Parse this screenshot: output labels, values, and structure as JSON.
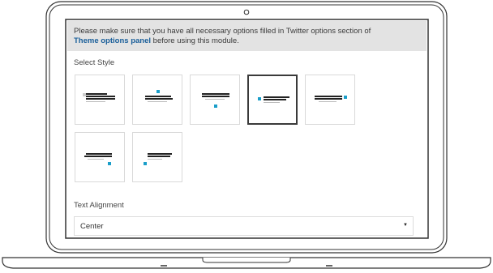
{
  "notice": {
    "text": "Please make sure that you have all necessary options filled in Twitter options section of",
    "link_text": "Theme options panel",
    "suffix": "before using this module."
  },
  "select_style": {
    "label": "Select Style",
    "selected_index": 3,
    "styles": [
      {
        "id": "style-1",
        "icon": "tweet-lines-top-left-dot-icon"
      },
      {
        "id": "style-2",
        "icon": "tweet-lines-dot-top-icon"
      },
      {
        "id": "style-3",
        "icon": "tweet-lines-dot-bottom-icon"
      },
      {
        "id": "style-4",
        "icon": "tweet-lines-dot-left-icon"
      },
      {
        "id": "style-5",
        "icon": "tweet-lines-dot-right-icon"
      },
      {
        "id": "style-6",
        "icon": "tweet-lines-dot-bottom-right-icon"
      },
      {
        "id": "style-7",
        "icon": "tweet-lines-dot-bottom-left-icon"
      }
    ]
  },
  "text_alignment": {
    "label": "Text Alignment",
    "value": "Center",
    "arrow": "▼"
  },
  "colors": {
    "accent": "#1a9ec9",
    "link": "#1a5f9a",
    "notice_bg": "#e3e3e3",
    "frame": "#333333"
  }
}
